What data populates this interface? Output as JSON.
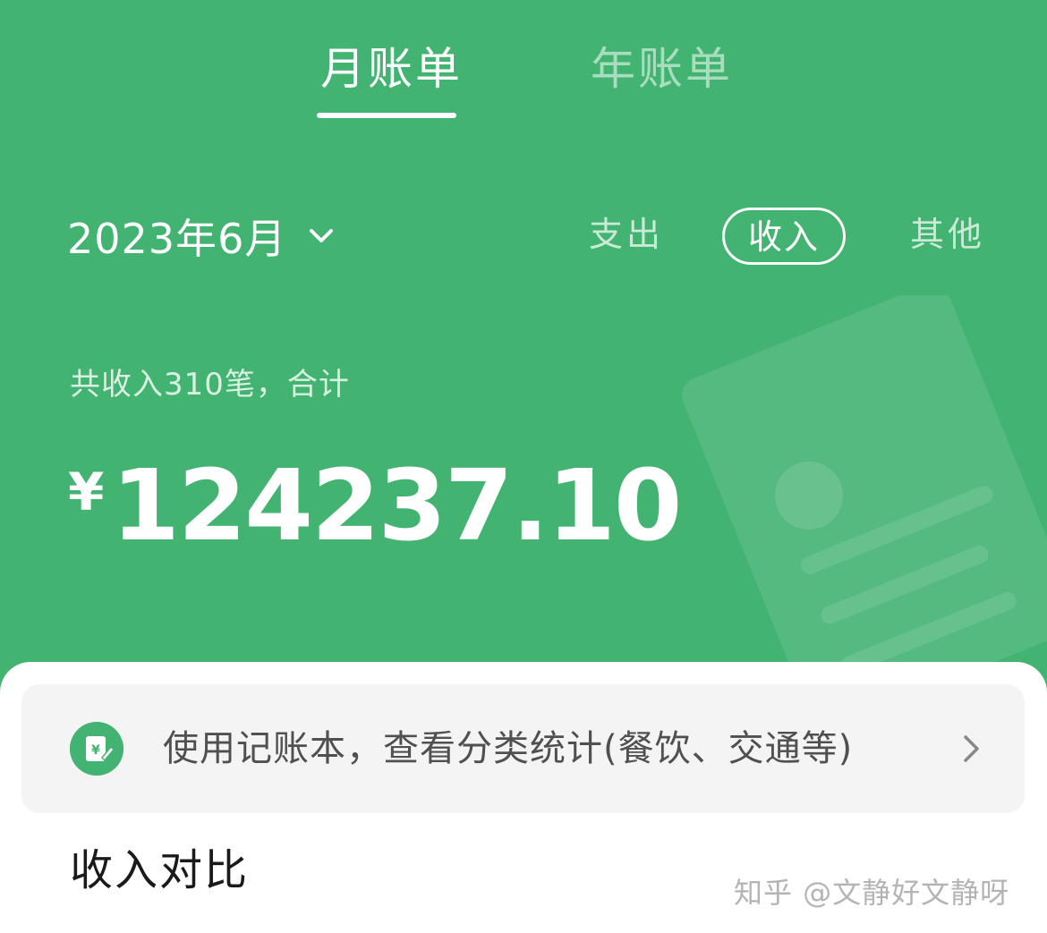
{
  "tabs": {
    "month": "月账单",
    "year": "年账单",
    "active": "month"
  },
  "date_selector": {
    "label": "2023年6月",
    "icon": "chevron-down-icon"
  },
  "filters": {
    "expense": "支出",
    "income": "收入",
    "other": "其他",
    "selected": "income"
  },
  "summary": {
    "caption": "共收入310笔，合计",
    "currency": "¥",
    "amount": "124237.10"
  },
  "promo": {
    "icon": "ledger-yuan-icon",
    "text": "使用记账本，查看分类统计(餐饮、交通等)",
    "chevron": "chevron-right-icon"
  },
  "section": {
    "title": "收入对比"
  },
  "watermark": "知乎 @文静好文静呀",
  "colors": {
    "brand_green": "#42b371",
    "panel_bg": "#ffffff",
    "promo_bg": "#f4f4f4"
  }
}
